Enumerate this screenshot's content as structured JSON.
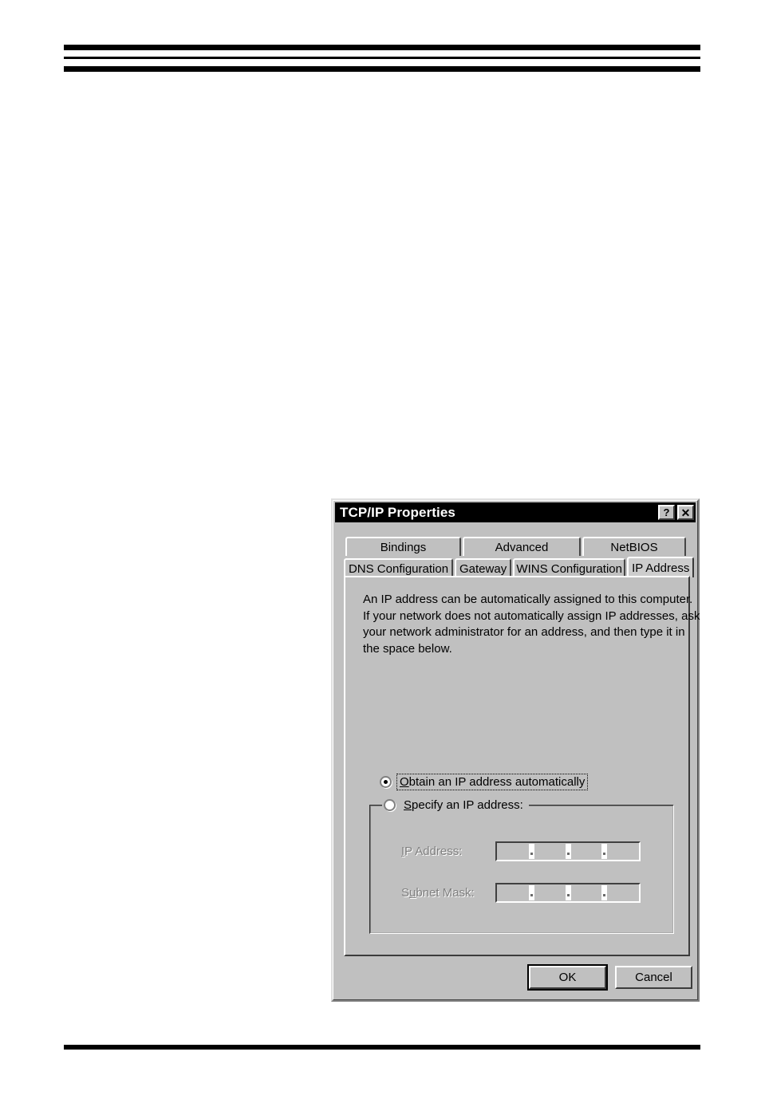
{
  "page": {
    "rules": {
      "header_top_thick": true,
      "header_mid_thin": true,
      "header_bottom_thick": true,
      "footer_thick": true
    }
  },
  "dialog": {
    "title": "TCP/IP Properties",
    "titlebar": {
      "help_button": "?",
      "close_button": "✕",
      "help_icon_name": "help-icon",
      "close_icon_name": "close-icon"
    },
    "tabs": {
      "row1": [
        {
          "label": "Bindings",
          "active": false
        },
        {
          "label": "Advanced",
          "active": false
        },
        {
          "label": "NetBIOS",
          "active": false
        }
      ],
      "row2": [
        {
          "label": "DNS Configuration",
          "active": false
        },
        {
          "label": "Gateway",
          "active": false
        },
        {
          "label": "WINS Configuration",
          "active": false
        },
        {
          "label": "IP Address",
          "active": true
        }
      ],
      "selected": "IP Address"
    },
    "description": {
      "line1": "An IP address can be automatically assigned to this computer.",
      "line2": "If your network does not automatically assign IP addresses, ask",
      "line3": "your network administrator for an address, and then type it in",
      "line4": "the space below."
    },
    "radio_auto": {
      "label_accel": "O",
      "label_rest": "btain an IP address automatically",
      "selected": true,
      "focused": true
    },
    "radio_specify": {
      "label_accel": "S",
      "label_rest": "pecify an IP address:",
      "selected": false
    },
    "fields": {
      "ip_address": {
        "label_pre": "",
        "label_accel": "I",
        "label_rest": "P Address:",
        "value": "",
        "octets": [
          "",
          "",
          "",
          ""
        ],
        "separator": ".",
        "enabled": false
      },
      "subnet_mask": {
        "label_pre": "S",
        "label_accel": "u",
        "label_rest": "bnet Mask:",
        "value": "",
        "octets": [
          "",
          "",
          "",
          ""
        ],
        "separator": ".",
        "enabled": false
      }
    },
    "buttons": {
      "ok": "OK",
      "cancel": "Cancel",
      "default": "OK"
    },
    "colors": {
      "face": "#c0c0c0",
      "titlebar_bg": "#000000",
      "titlebar_text": "#ffffff",
      "shadow": "#808080",
      "highlight": "#ffffff",
      "disabled_text": "#808080",
      "text": "#000000"
    }
  }
}
